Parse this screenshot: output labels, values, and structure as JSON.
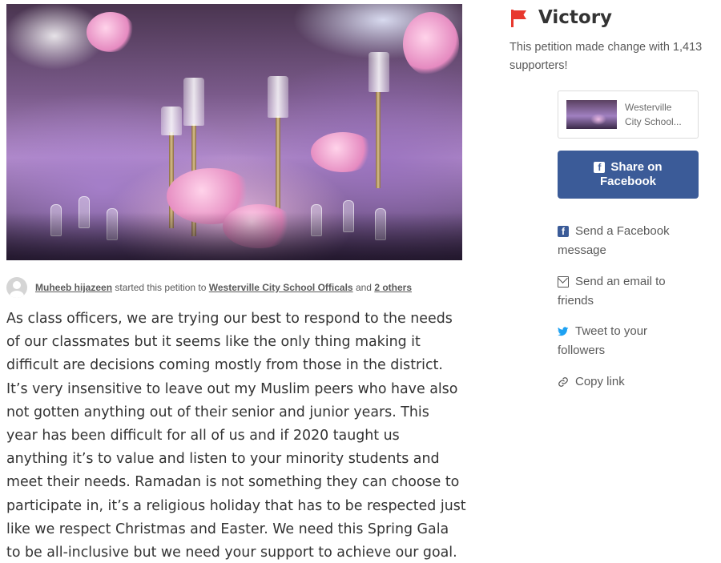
{
  "petition": {
    "starter_name": "Muheeb hijazeen",
    "started_text": " started this petition to ",
    "target_name": "Westerville City School Officals",
    "and_text": " and ",
    "others_text": "2 others"
  },
  "description": {
    "lines": [
      "As class officers, we are trying our best to respond to the needs",
      "of our classmates but it seems like the only thing making it",
      "difficult are decisions coming mostly from those in the district.",
      "It’s very insensitive to leave out my Muslim peers who have also",
      "not gotten anything out of their senior and junior years. This",
      "year has been difficult for all of us and if 2020 taught us",
      "anything it’s to value and listen to your minority students and",
      "meet their needs. Ramadan is not something they can choose to",
      "participate in, it’s a religious holiday that has to be respected just",
      "like we respect Christmas and Easter. We need this Spring Gala",
      "to be all-inclusive but we need your support to achieve our goal."
    ]
  },
  "sidebar": {
    "status_title": "Victory",
    "status_icon": "flag-icon",
    "status_color": "#e8382e",
    "victory_text": "This petition made change with 1,413 supporters!",
    "card_title_line1": "Westerville",
    "card_title_line2": "City School...",
    "share_facebook_line1": "Share on",
    "share_facebook_line2": "Facebook",
    "facebook_color": "#3b5b98",
    "send_facebook_line1": "Send a Facebook",
    "send_facebook_line2": "message",
    "send_email_line1": "Send an email to",
    "send_email_line2": "friends",
    "tweet_line1": "Tweet to your",
    "tweet_line2": "followers",
    "copy_link": "Copy link"
  },
  "icons": {
    "facebook": "f",
    "twitter": "🐦",
    "link": "🔗"
  }
}
